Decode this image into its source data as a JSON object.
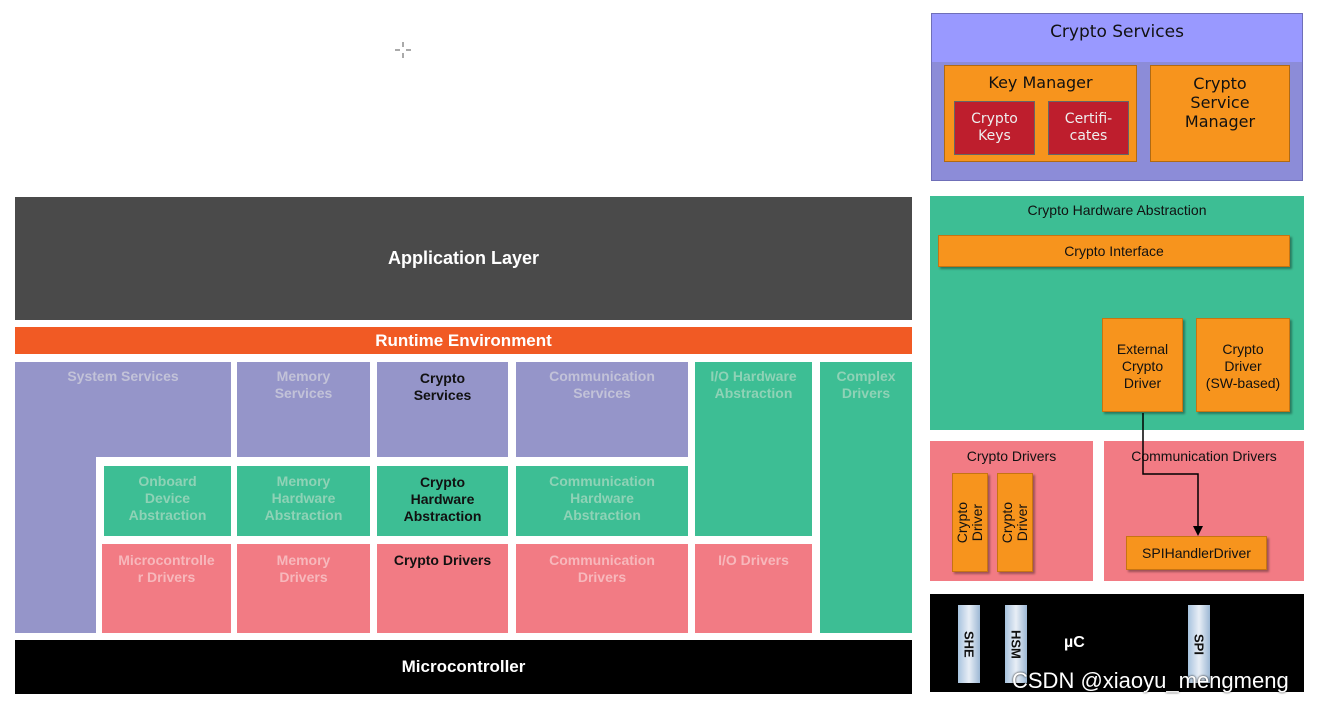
{
  "left": {
    "application_layer": "Application Layer",
    "runtime_environment": "Runtime Environment",
    "system_services": "System Services",
    "memory_services": "Memory\nServices",
    "crypto_services": "Crypto\nServices",
    "communication_services": "Communication\nServices",
    "io_hw_abstraction": "I/O Hardware\nAbstraction",
    "complex_drivers": "Complex\nDrivers",
    "onboard_device_abstraction": "Onboard\nDevice\nAbstraction",
    "memory_hw_abstraction": "Memory\nHardware\nAbstraction",
    "crypto_hw_abstraction": "Crypto\nHardware\nAbstraction",
    "communication_hw_abstraction": "Communication\nHardware\nAbstraction",
    "microcontroller_drivers": "Microcontrolle\nr Drivers",
    "memory_drivers": "Memory\nDrivers",
    "crypto_drivers": "Crypto Drivers",
    "communication_drivers": "Communication\nDrivers",
    "io_drivers": "I/O Drivers",
    "microcontroller": "Microcontroller"
  },
  "right": {
    "crypto_services_title": "Crypto Services",
    "key_manager": "Key Manager",
    "crypto_keys": "Crypto\nKeys",
    "certificates": "Certifi-\ncates",
    "crypto_service_manager": "Crypto\nService\nManager",
    "crypto_hw_abstraction_title": "Crypto Hardware Abstraction",
    "crypto_interface": "Crypto Interface",
    "external_crypto_driver": "External\nCrypto\nDriver",
    "crypto_driver_sw": "Crypto\nDriver\n(SW-based)",
    "crypto_drivers_title": "Crypto Drivers",
    "crypto_driver_v1": "Crypto\nDriver",
    "crypto_driver_v2": "Crypto\nDriver",
    "communication_drivers_title": "Communication Drivers",
    "spi_handler_driver": "SPIHandlerDriver",
    "she": "SHE",
    "hsm": "HSM",
    "uc": "µC",
    "spi": "SPI"
  },
  "watermark": "CSDN @xiaoyu_mengmeng",
  "colors": {
    "application": "#4a4a4a",
    "rte": "#f15a24",
    "services": "#9595c9",
    "abstraction": "#3dbe94",
    "drivers": "#f27b84",
    "microcontroller": "#000000",
    "orange": "#f7941d",
    "crimson": "#be1e2d"
  }
}
